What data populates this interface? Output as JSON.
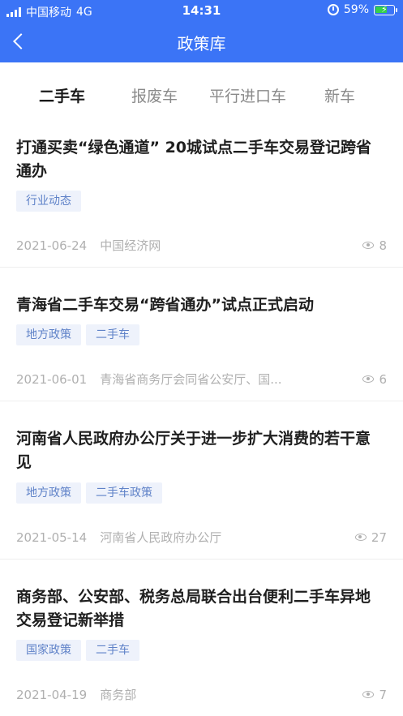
{
  "status_bar": {
    "carrier": "中国移动",
    "network": "4G",
    "time": "14:31",
    "battery": "59%"
  },
  "header": {
    "title": "政策库"
  },
  "tabs": [
    {
      "label": "二手车",
      "active": true
    },
    {
      "label": "报废车",
      "active": false
    },
    {
      "label": "平行进口车",
      "active": false
    },
    {
      "label": "新车",
      "active": false
    }
  ],
  "articles": [
    {
      "title": "打通买卖“绿色通道” 20城试点二手车交易登记跨省通办",
      "tags": [
        "行业动态"
      ],
      "date": "2021-06-24",
      "source": "中国经济网",
      "views": "8"
    },
    {
      "title": "青海省二手车交易“跨省通办”试点正式启动",
      "tags": [
        "地方政策",
        "二手车"
      ],
      "date": "2021-06-01",
      "source": "青海省商务厅会同省公安厅、国...",
      "views": "6"
    },
    {
      "title": "河南省人民政府办公厅关于进一步扩大消费的若干意见",
      "tags": [
        "地方政策",
        "二手车政策"
      ],
      "date": "2021-05-14",
      "source": "河南省人民政府办公厅",
      "views": "27"
    },
    {
      "title": "商务部、公安部、税务总局联合出台便利二手车异地交易登记新举措",
      "tags": [
        "国家政策",
        "二手车"
      ],
      "date": "2021-04-19",
      "source": "商务部",
      "views": "7"
    }
  ],
  "colors": {
    "brand": "#3b74f6",
    "tag_bg": "#eef2fb",
    "tag_text": "#5f82c8"
  }
}
